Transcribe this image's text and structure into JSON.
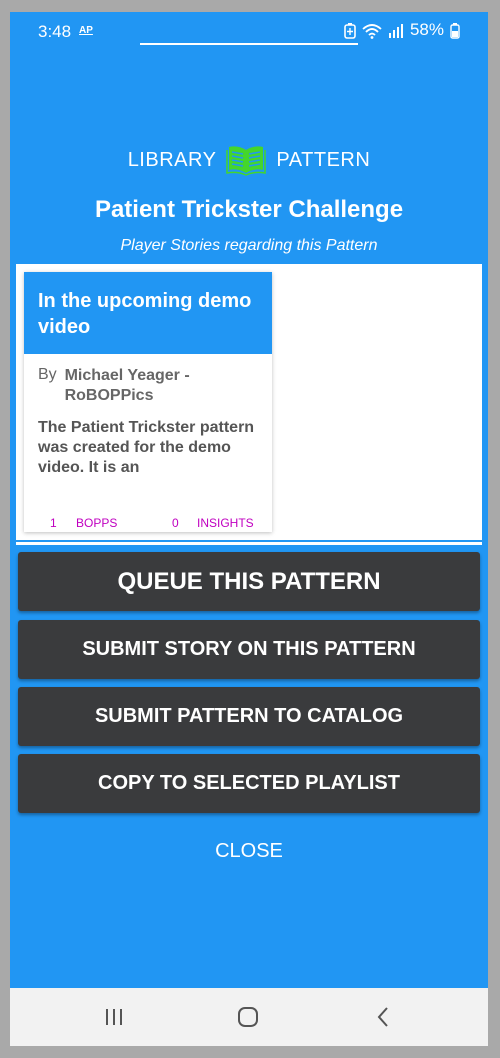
{
  "status_bar": {
    "time": "3:48",
    "ap_badge": "AP",
    "battery_percent": "58%",
    "icons": [
      "battery-saver-icon",
      "wifi-icon",
      "signal-icon",
      "battery-icon"
    ]
  },
  "header": {
    "left_label": "LIBRARY",
    "right_label": "PATTERN",
    "icon": "open-book-icon",
    "icon_color": "#44d62c"
  },
  "title": "Patient Trickster Challenge",
  "subtitle": "Player Stories regarding this Pattern",
  "stories": [
    {
      "title": "In the upcoming demo video",
      "by_label": "By",
      "author": "Michael Yeager - RoBOPPics",
      "excerpt": "The Patient Trickster pattern was created for the demo video. It is an",
      "bopps_count": "1",
      "bopps_label": "BOPPS",
      "insights_count": "0",
      "insights_label": "INSIGHTS"
    }
  ],
  "buttons": {
    "queue": "QUEUE THIS PATTERN",
    "submit_story": "SUBMIT STORY ON THIS PATTERN",
    "submit_catalog": "SUBMIT PATTERN TO CATALOG",
    "copy_playlist": "COPY TO SELECTED PLAYLIST",
    "close": "CLOSE"
  },
  "nav_bar": {
    "icons": [
      "recent-apps-icon",
      "home-icon",
      "back-icon"
    ]
  },
  "colors": {
    "background": "#2196f3",
    "button": "#3a3b3d",
    "stat_text": "#c000c0"
  }
}
